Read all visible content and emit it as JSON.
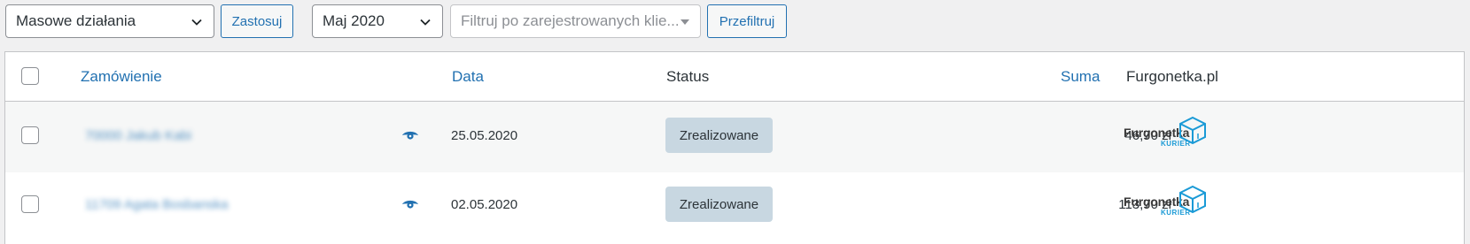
{
  "toolbar": {
    "bulk_actions": "Masowe działania",
    "apply_label": "Zastosuj",
    "month": "Maj 2020",
    "customer_filter_placeholder": "Filtruj po zarejestrowanych klie...",
    "filter_label": "Przefiltruj"
  },
  "table": {
    "headers": {
      "order": "Zamówienie",
      "date": "Data",
      "status": "Status",
      "total": "Suma",
      "shipping": "Furgonetka.pl"
    },
    "rows": [
      {
        "order": "70000 Jakub Kabi",
        "date": "25.05.2020",
        "status": "Zrealizowane",
        "total": "46,70 zł",
        "logo_brand": "Furgonetka",
        "logo_sub": "KURIER"
      },
      {
        "order": "11709 Agata Bosbanska",
        "date": "02.05.2020",
        "status": "Zrealizowane",
        "total": "113,70 zł",
        "logo_brand": "Furgonetka",
        "logo_sub": "KURIER"
      }
    ]
  },
  "colors": {
    "accent": "#2271b1",
    "status_bg": "#c8d7e1",
    "logo_blue": "#1a9ad6"
  }
}
